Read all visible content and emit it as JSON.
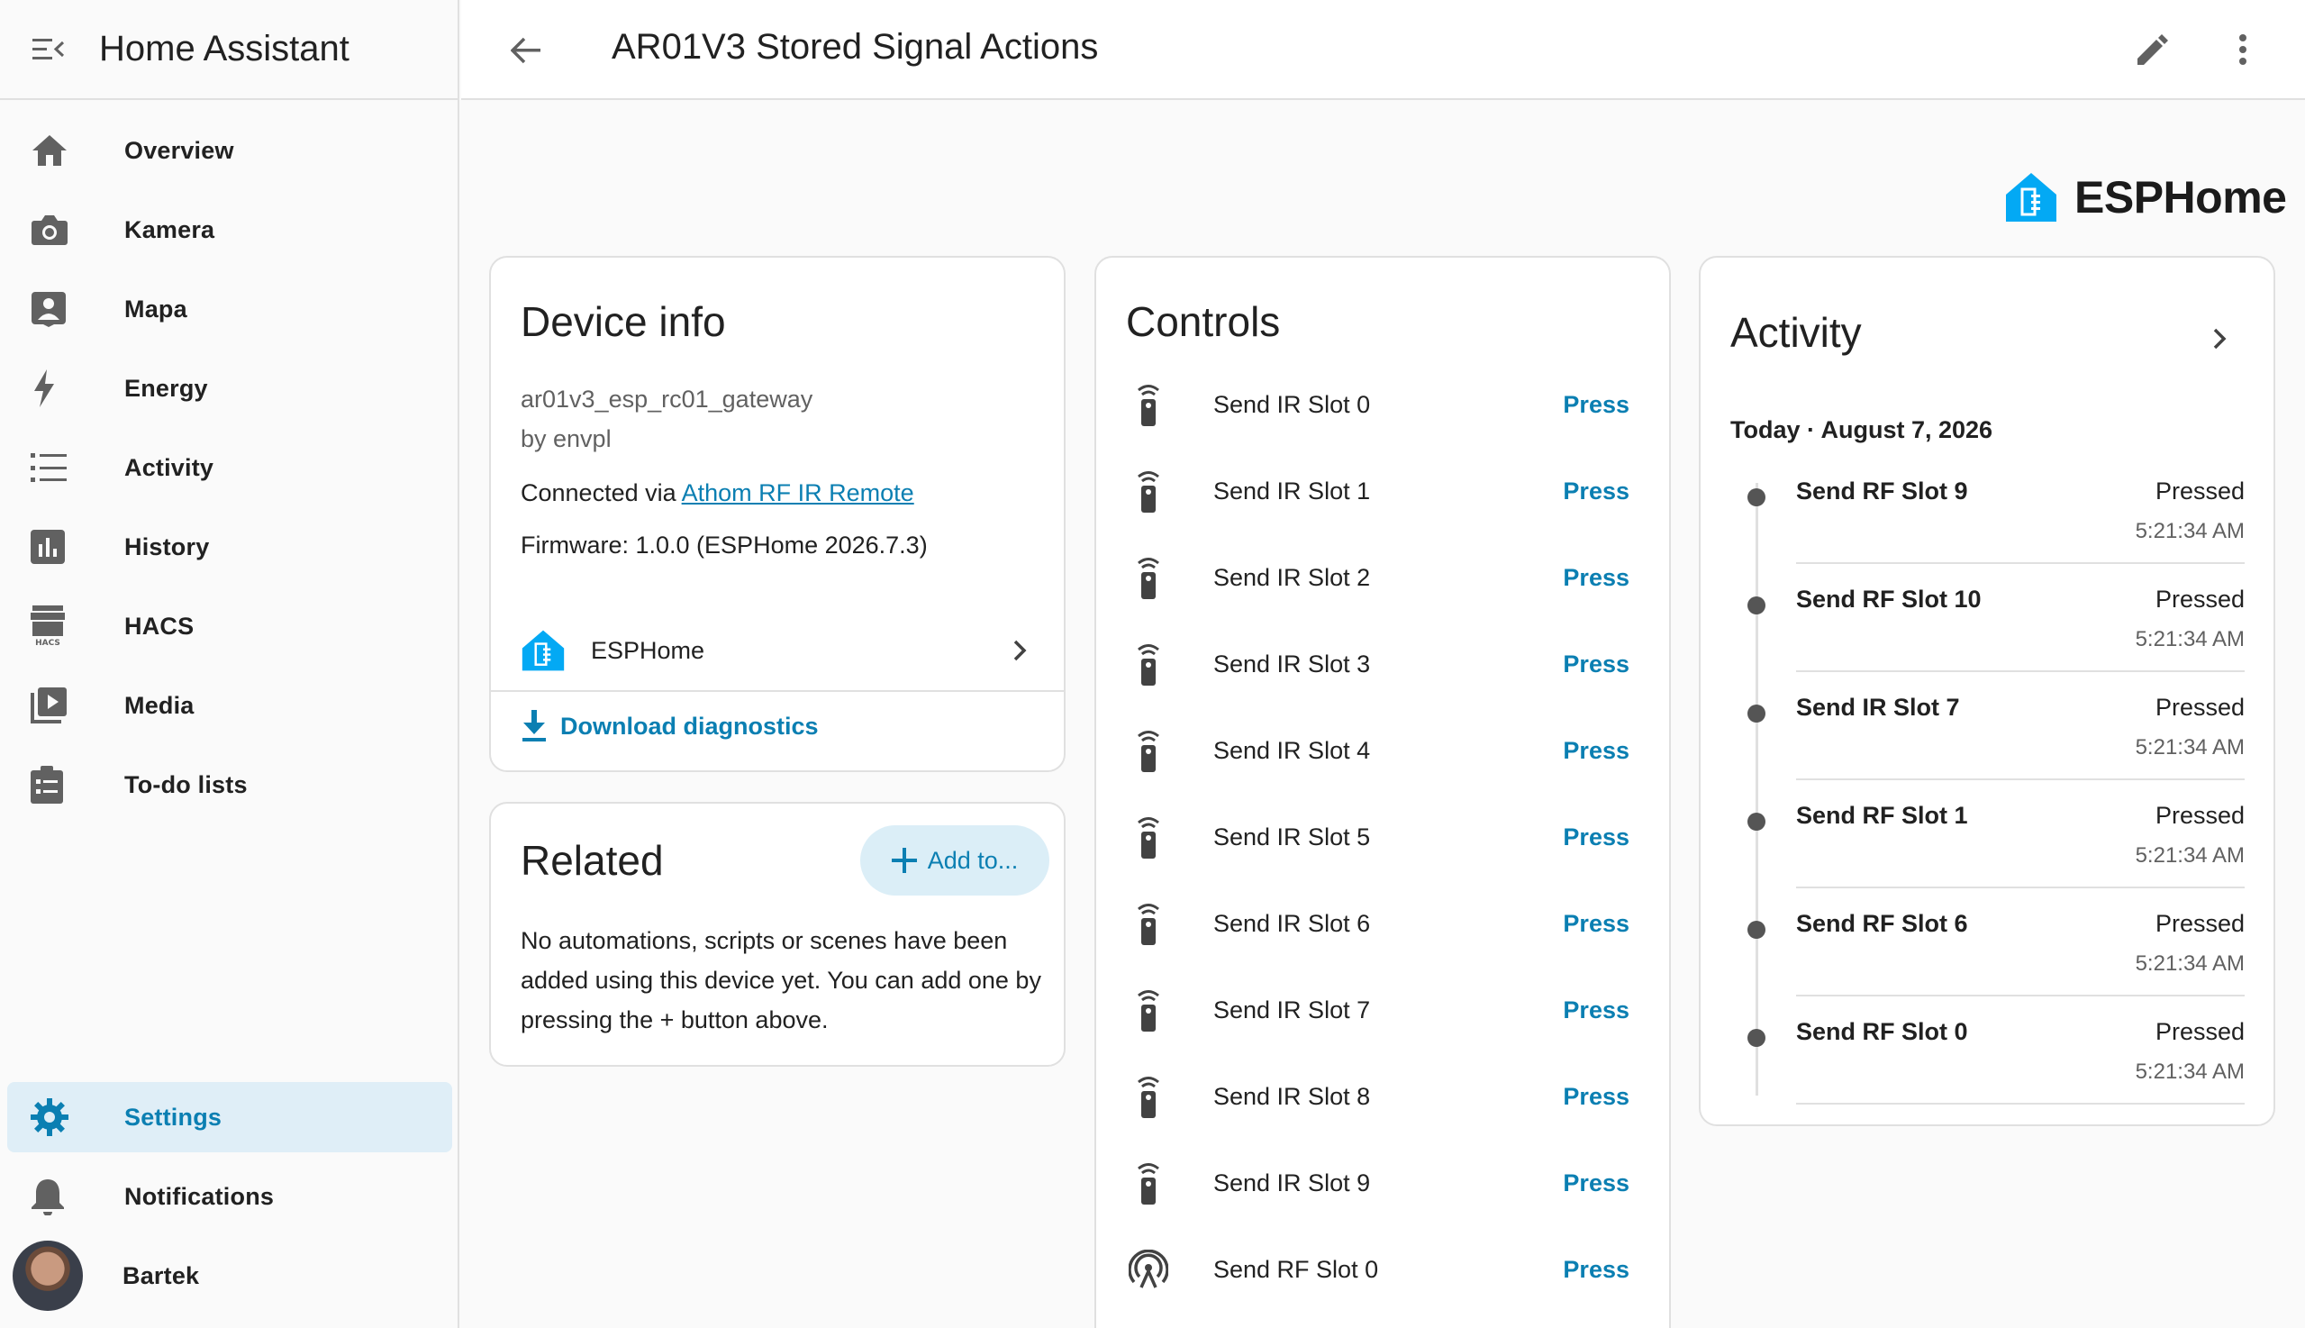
{
  "app_title": "Home Assistant",
  "page_title": "AR01V3 Stored Signal Actions",
  "sidebar": {
    "items": [
      {
        "label": "Overview",
        "icon": "home-icon"
      },
      {
        "label": "Kamera",
        "icon": "camera-icon"
      },
      {
        "label": "Mapa",
        "icon": "map-account-icon"
      },
      {
        "label": "Energy",
        "icon": "lightning-icon"
      },
      {
        "label": "Activity",
        "icon": "format-list-icon"
      },
      {
        "label": "History",
        "icon": "chart-box-icon"
      },
      {
        "label": "HACS",
        "icon": "hacs-icon"
      },
      {
        "label": "Media",
        "icon": "play-box-icon"
      },
      {
        "label": "To-do lists",
        "icon": "clipboard-list-icon"
      }
    ],
    "settings_label": "Settings",
    "notifications_label": "Notifications",
    "user_name": "Bartek"
  },
  "brand": {
    "name": "ESPHome",
    "color": "#03a9f4"
  },
  "device_info": {
    "title": "Device info",
    "device_name": "ar01v3_esp_rc01_gateway",
    "by": "by envpl",
    "connected_prefix": "Connected via ",
    "connected_link": "Athom RF IR Remote",
    "firmware": "Firmware: 1.0.0 (ESPHome 2026.7.3)",
    "integration": "ESPHome",
    "download_label": "Download diagnostics"
  },
  "related": {
    "title": "Related",
    "add_label": "Add to...",
    "empty_text": "No automations, scripts or scenes have been added using this device yet. You can add one by pressing the + button above."
  },
  "controls": {
    "title": "Controls",
    "action_label": "Press",
    "items": [
      {
        "name": "Send IR Slot 0",
        "icon": "remote-icon"
      },
      {
        "name": "Send IR Slot 1",
        "icon": "remote-icon"
      },
      {
        "name": "Send IR Slot 2",
        "icon": "remote-icon"
      },
      {
        "name": "Send IR Slot 3",
        "icon": "remote-icon"
      },
      {
        "name": "Send IR Slot 4",
        "icon": "remote-icon"
      },
      {
        "name": "Send IR Slot 5",
        "icon": "remote-icon"
      },
      {
        "name": "Send IR Slot 6",
        "icon": "remote-icon"
      },
      {
        "name": "Send IR Slot 7",
        "icon": "remote-icon"
      },
      {
        "name": "Send IR Slot 8",
        "icon": "remote-icon"
      },
      {
        "name": "Send IR Slot 9",
        "icon": "remote-icon"
      },
      {
        "name": "Send RF Slot 0",
        "icon": "access-point-icon"
      }
    ]
  },
  "activity": {
    "title": "Activity",
    "date": "Today · August 7, 2026",
    "entries": [
      {
        "name": "Send RF Slot 9",
        "state": "Pressed",
        "time": "5:21:34 AM"
      },
      {
        "name": "Send RF Slot 10",
        "state": "Pressed",
        "time": "5:21:34 AM"
      },
      {
        "name": "Send IR Slot 7",
        "state": "Pressed",
        "time": "5:21:34 AM"
      },
      {
        "name": "Send RF Slot 1",
        "state": "Pressed",
        "time": "5:21:34 AM"
      },
      {
        "name": "Send RF Slot 6",
        "state": "Pressed",
        "time": "5:21:34 AM"
      },
      {
        "name": "Send RF Slot 0",
        "state": "Pressed",
        "time": "5:21:34 AM"
      }
    ]
  },
  "colors": {
    "accent": "#0b7fb2",
    "active_bg": "#dfeef7",
    "icon_gray": "#616161"
  }
}
